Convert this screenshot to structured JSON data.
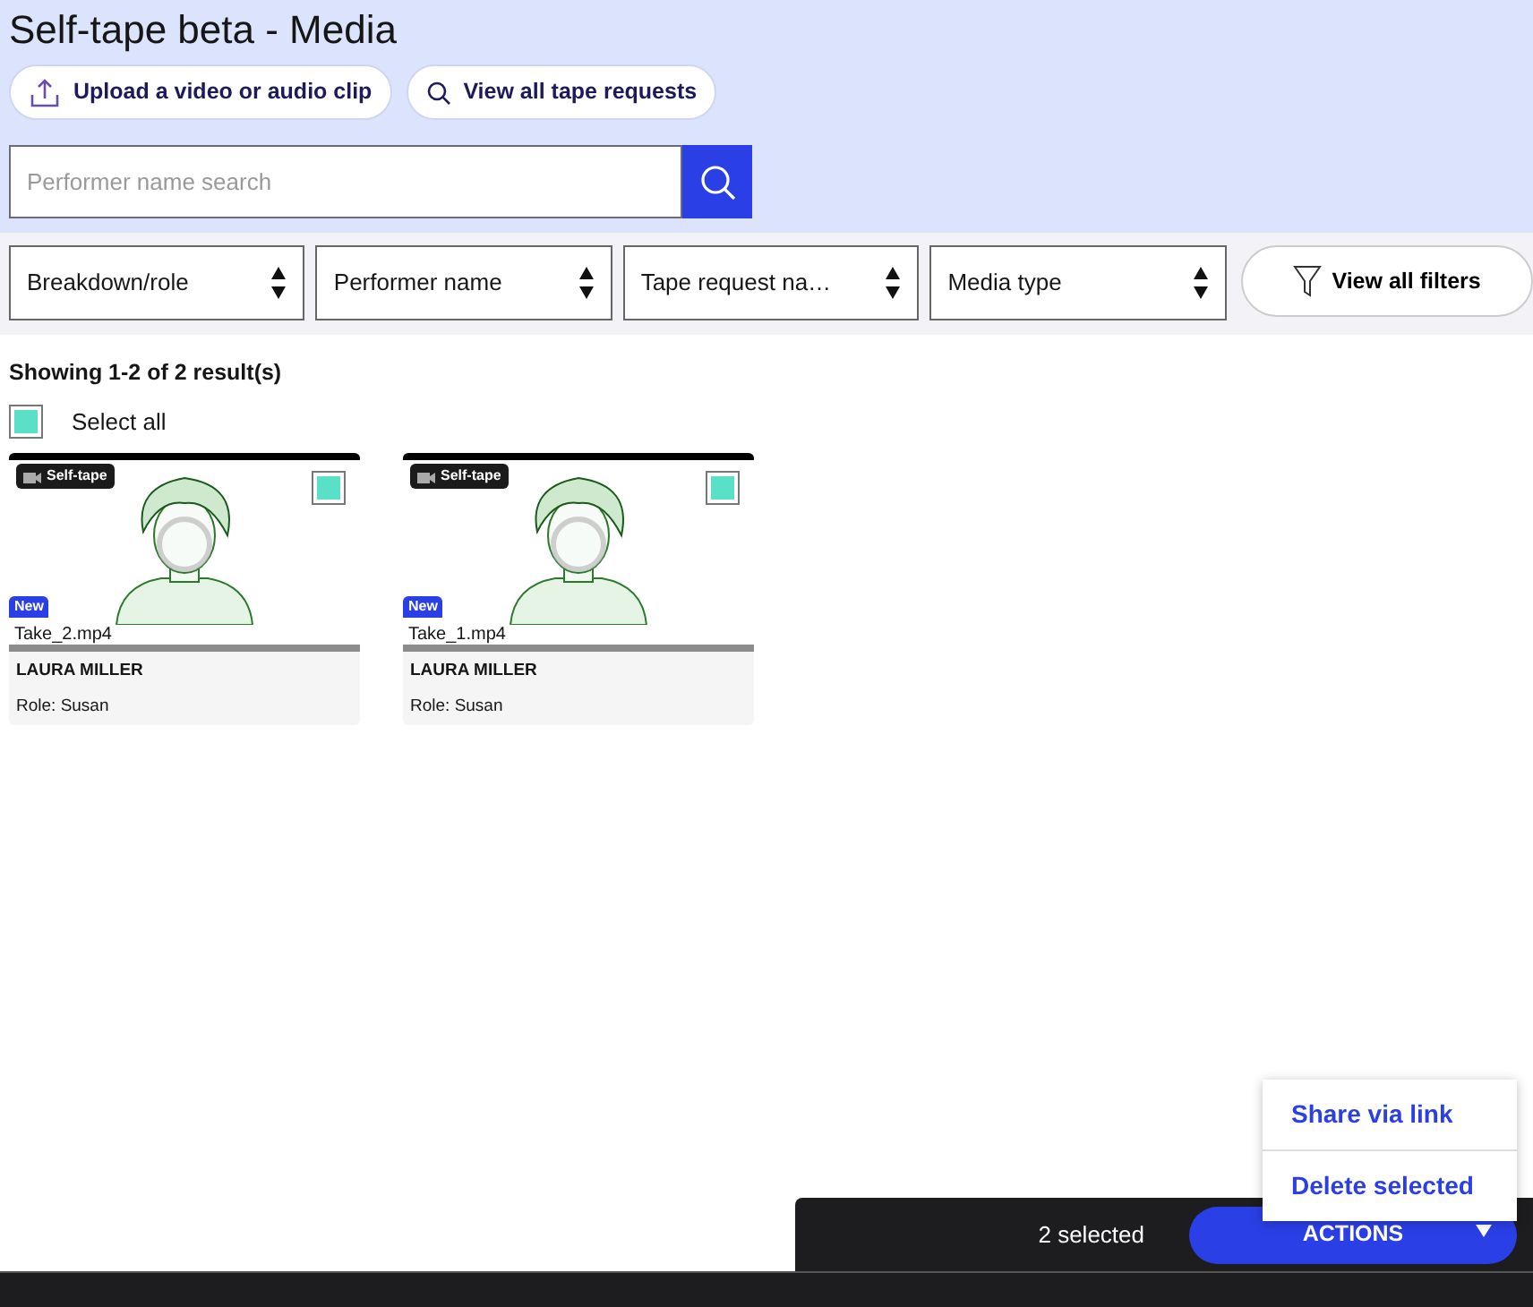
{
  "header": {
    "title": "Self-tape beta - Media",
    "buttons": [
      {
        "kind": "upload",
        "label": "Upload a video or audio clip"
      },
      {
        "kind": "search",
        "label": "View all tape requests"
      }
    ],
    "search": {
      "placeholder": "Performer name search"
    }
  },
  "filters": [
    {
      "label": "Breakdown/role"
    },
    {
      "label": "Performer name"
    },
    {
      "label": "Tape request na…"
    },
    {
      "label": "Media type"
    }
  ],
  "view_all_filters": "View all filters",
  "results": {
    "summary": "Showing 1-2 of 2 result(s)",
    "select_all": {
      "label": "Select all",
      "checked": true
    }
  },
  "cards": [
    {
      "badge": "Self-tape",
      "checked": true,
      "new_label": "New",
      "filename": "Take_2.mp4",
      "performer": "LAURA MILLER",
      "role": "Role: Susan"
    },
    {
      "badge": "Self-tape",
      "checked": true,
      "new_label": "New",
      "filename": "Take_1.mp4",
      "performer": "LAURA MILLER",
      "role": "Role: Susan"
    }
  ],
  "action_bar": {
    "count": "2 selected",
    "button": "ACTIONS",
    "expanded": true,
    "menu": [
      "Share via link",
      "Delete selected"
    ]
  }
}
